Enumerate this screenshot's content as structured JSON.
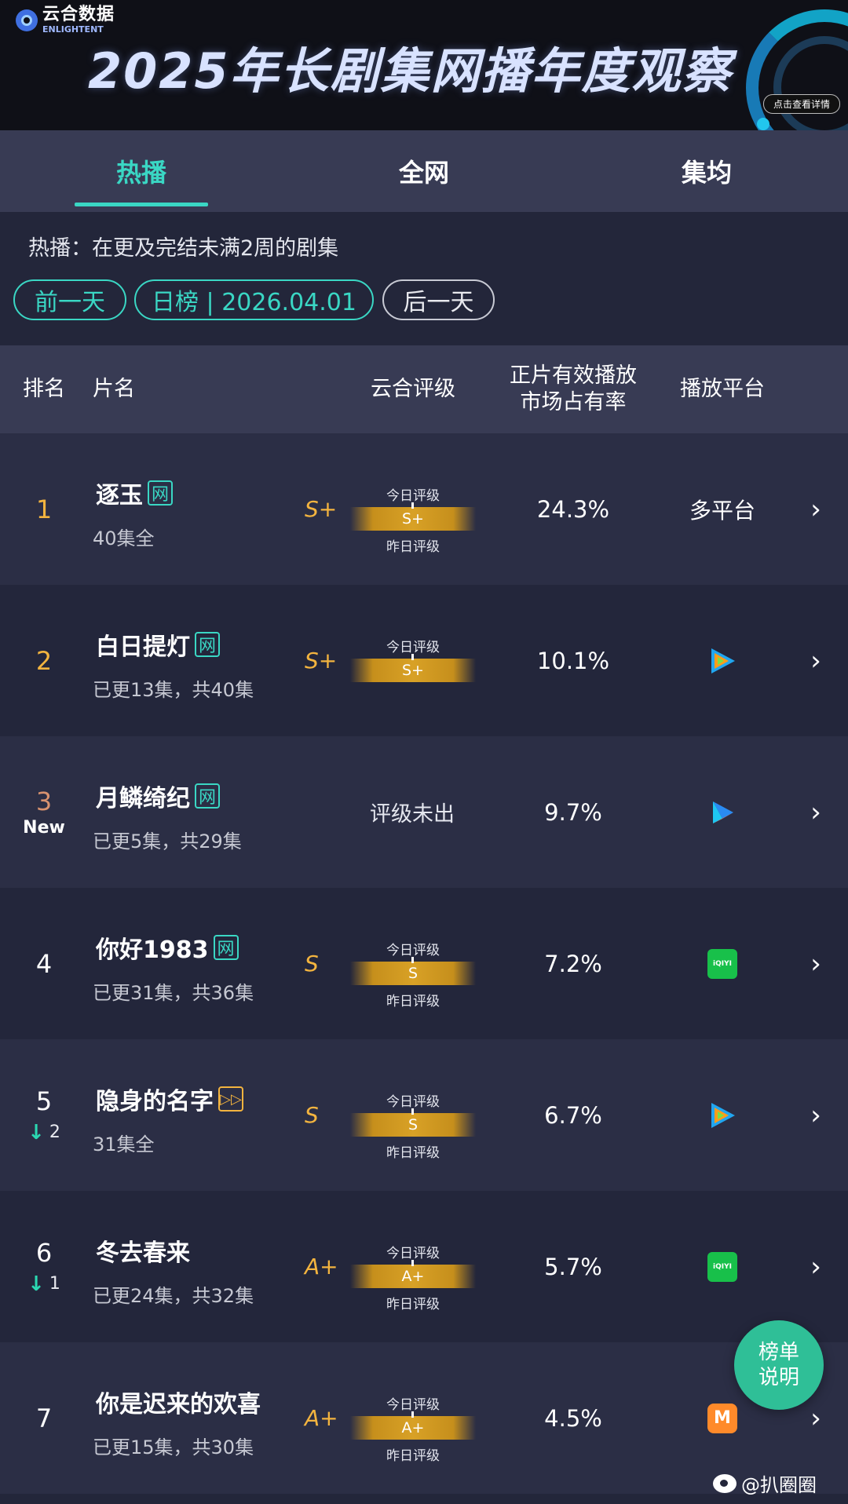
{
  "banner": {
    "logo_cn": "云合数据",
    "logo_en": "ENLIGHTENT",
    "title": "2025年长剧集网播年度观察",
    "detail_button": "点击查看详情"
  },
  "tabs": [
    {
      "label": "热播",
      "active": true
    },
    {
      "label": "全网",
      "active": false
    },
    {
      "label": "集均",
      "active": false
    }
  ],
  "description": "热播：在更及完结未满2周的剧集",
  "date_nav": {
    "prev": "前一天",
    "current": "日榜 | 2026.04.01",
    "next": "后一天"
  },
  "table_header": {
    "rank": "排名",
    "title": "片名",
    "grade": "云合评级",
    "share_line1": "正片有效播放",
    "share_line2": "市场占有率",
    "platform": "播放平台"
  },
  "grade_labels": {
    "today": "今日评级",
    "yesterday": "昨日评级",
    "none": "评级未出"
  },
  "rows": [
    {
      "rank": "1",
      "rank_sub": "",
      "move": "",
      "title": "逐玉",
      "badge": "网",
      "episodes": "40集全",
      "grade": "S+",
      "grade_bar": "S+",
      "grade_yesterday_shown": true,
      "share": "24.3%",
      "platform": "多平台",
      "platform_icon": "text"
    },
    {
      "rank": "2",
      "rank_sub": "",
      "move": "",
      "title": "白日提灯",
      "badge": "网",
      "episodes": "已更13集，共40集",
      "grade": "S+",
      "grade_bar": "S+",
      "grade_yesterday_shown": false,
      "share": "10.1%",
      "platform": "",
      "platform_icon": "tencent-video-icon"
    },
    {
      "rank": "3",
      "rank_sub": "New",
      "move": "",
      "title": "月鳞绮纪",
      "badge": "网",
      "episodes": "已更5集，共29集",
      "grade": "",
      "grade_bar": "",
      "grade_yesterday_shown": false,
      "share": "9.7%",
      "platform": "",
      "platform_icon": "youku-icon"
    },
    {
      "rank": "4",
      "rank_sub": "",
      "move": "",
      "title": "你好1983",
      "badge": "网",
      "episodes": "已更31集，共36集",
      "grade": "S",
      "grade_bar": "S",
      "grade_yesterday_shown": true,
      "share": "7.2%",
      "platform": "",
      "platform_icon": "iqiyi-icon"
    },
    {
      "rank": "5",
      "rank_sub": "",
      "move": "2",
      "title": "隐身的名字",
      "badge": "▷▷",
      "episodes": "31集全",
      "grade": "S",
      "grade_bar": "S",
      "grade_yesterday_shown": true,
      "share": "6.7%",
      "platform": "",
      "platform_icon": "tencent-video-icon"
    },
    {
      "rank": "6",
      "rank_sub": "",
      "move": "1",
      "title": "冬去春来",
      "badge": "",
      "episodes": "已更24集，共32集",
      "grade": "A+",
      "grade_bar": "A+",
      "grade_yesterday_shown": true,
      "share": "5.7%",
      "platform": "",
      "platform_icon": "iqiyi-icon"
    },
    {
      "rank": "7",
      "rank_sub": "",
      "move": "",
      "title": "你是迟来的欢喜",
      "badge": "",
      "episodes": "已更15集，共30集",
      "grade": "A+",
      "grade_bar": "A+",
      "grade_yesterday_shown": true,
      "share": "4.5%",
      "platform": "",
      "platform_icon": "mango-tv-icon"
    }
  ],
  "iqiyi_text": "iQIYI",
  "mango_text": "M",
  "fab": {
    "line1": "榜单",
    "line2": "说明"
  },
  "watermark": "@扒圈圈",
  "colors": {
    "accent": "#3ad7c4",
    "gold": "#f3b43f",
    "rank_up_down": "#2bd8b2",
    "fab": "#2fbf97"
  }
}
